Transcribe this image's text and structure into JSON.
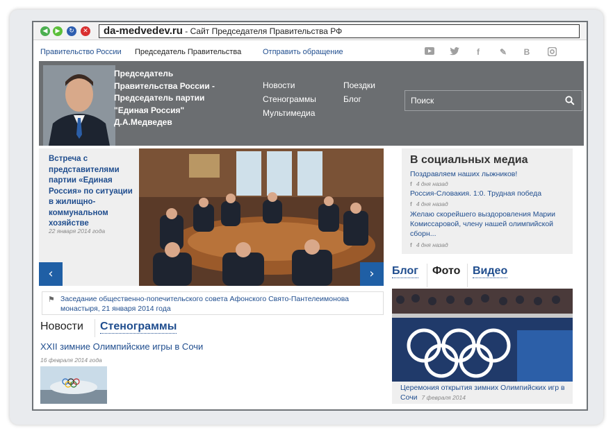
{
  "browser": {
    "domain": "da-medvedev.ru",
    "title_suffix": " - Сайт Председателя Правительства РФ",
    "buttons": {
      "back": "◀",
      "forward": "▶",
      "reload": "↻",
      "close": "✕"
    },
    "button_colors": {
      "back": "#4caf50",
      "forward": "#5cbf3a",
      "reload": "#2f5fb0",
      "close": "#d93030"
    }
  },
  "topnav": {
    "links": [
      "Правительство России",
      "Председатель Правительства",
      "Отправить обращение"
    ],
    "social_icons": [
      "youtube-icon",
      "twitter-icon",
      "facebook-icon",
      "livejournal-icon",
      "vkontakte-icon",
      "instagram-icon"
    ]
  },
  "header": {
    "title_lines": [
      "Председатель",
      "Правительства России -",
      "Председатель партии",
      "\"Единая Россия\"",
      "Д.А.Медведев"
    ],
    "nav_col1": [
      "Новости",
      "Стенограммы",
      "Мультимедиа"
    ],
    "nav_col2": [
      "Поездки",
      "Блог"
    ],
    "search_placeholder": "Поиск"
  },
  "feature": {
    "headline": "Встреча с представителями партии «Единая Россия» по ситуации в жилищно-коммунальном хозяйстве",
    "date": "22 января 2014 года",
    "prev": "‹",
    "next": "›"
  },
  "event_caption": "Заседание общественно-попечительского совета Афонского Свято-Пантелеимонова монастыря, 21 января 2014 года",
  "news_tabs": {
    "active": "Новости",
    "other": "Стенограммы"
  },
  "news": {
    "headline": "XXII зимние Олимпийские игры в Сочи",
    "date": "16 февраля 2014 года"
  },
  "social_media": {
    "heading": "В социальных медиа",
    "items": [
      {
        "text": "Поздравляем наших лыжников!",
        "meta_icon": "f",
        "time": "4 дня назад"
      },
      {
        "text": "Россия-Словакия. 1:0. Трудная победа",
        "meta_icon": "f",
        "time": "4 дня назад"
      },
      {
        "text": "Желаю скорейшего выздоровления Марии Комиссаровой, члену нашей олимпийской сборн...",
        "meta_icon": "f",
        "time": "4 дня назад"
      }
    ]
  },
  "media_tabs": {
    "blog": "Блог",
    "photo": "Фото",
    "video": "Видео"
  },
  "photo_caption": {
    "text": "Церемония открытия зимних Олимпийских игр в Сочи",
    "date": "7 февраля 2014"
  },
  "colors": {
    "link": "#1f4d8e",
    "header_bg": "#6b6e71",
    "accent_blue": "#1f5fa5"
  }
}
